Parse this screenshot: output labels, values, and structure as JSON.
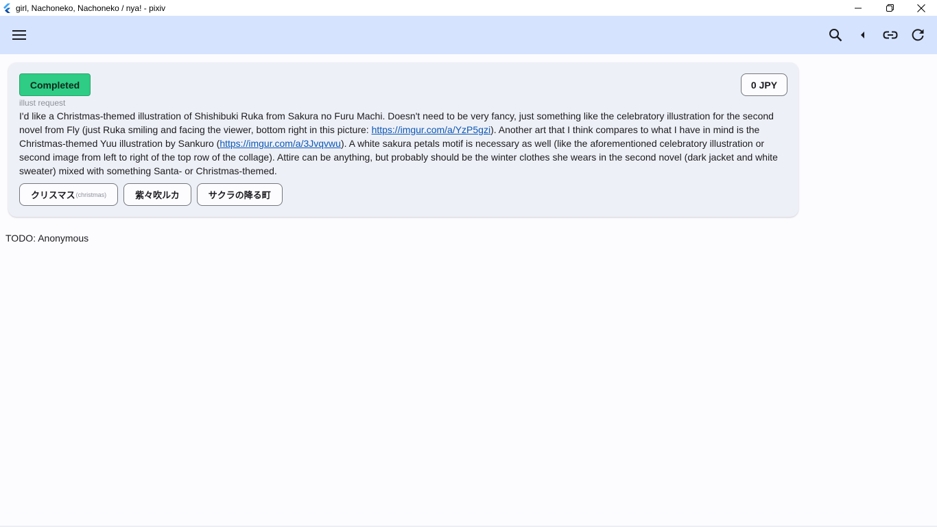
{
  "window": {
    "title": "girl, Nachoneko, Nachoneko / nya! - pixiv"
  },
  "appbar": {
    "icons": [
      "menu-icon",
      "search-icon",
      "arrow-left-icon",
      "link-icon",
      "refresh-icon"
    ]
  },
  "request": {
    "status": "Completed",
    "price": "0 JPY",
    "type": "illust request",
    "description": {
      "p1": "I'd like a Christmas-themed illustration of Shishibuki Ruka from Sakura no Furu Machi. Doesn't need to be very fancy, just something like the celebratory illustration for the second novel from Fly (just Ruka smiling and facing the viewer, bottom right in this picture: ",
      "link1": "https://imgur.com/a/YzP5gzi",
      "p2": "). Another art that I think compares to what I have in mind is the Christmas-themed Yuu illustration by Sankuro (",
      "link2": "https://imgur.com/a/3Jvqvwu",
      "p3": "). A white sakura petals motif is necessary as well (like the aforementioned celebratory illustration or second image from left to right of the top row of the collage). Attire can be anything, but probably should be the winter clothes she wears in the second novel (dark jacket and white sweater) mixed with something Santa- or Christmas-themed."
    },
    "tags": [
      {
        "label": "クリスマス",
        "translation": "(christmas)"
      },
      {
        "label": "紫々吹ルカ",
        "translation": ""
      },
      {
        "label": "サクラの降る町",
        "translation": ""
      }
    ]
  },
  "requester": "TODO: Anonymous",
  "colors": {
    "appbar": "#d5e3ff",
    "status_badge": "#2ecc85",
    "link": "#0b57b5"
  }
}
